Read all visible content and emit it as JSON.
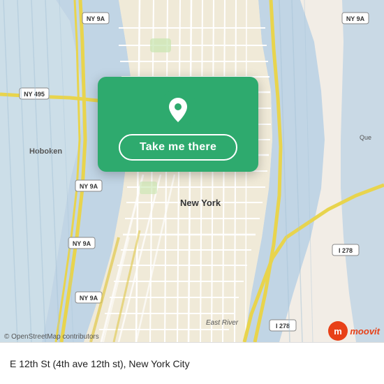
{
  "map": {
    "attribution": "© OpenStreetMap contributors",
    "background_color": "#e8ddd0"
  },
  "card": {
    "button_label": "Take me there"
  },
  "bottom_bar": {
    "location_text": "E 12th St (4th ave 12th st), New York City"
  },
  "moovit": {
    "text": "moovit"
  },
  "labels": {
    "hoboken": "Hoboken",
    "new_york": "New York",
    "ny_9a_1": "NY 9A",
    "ny_9a_2": "NY 9A",
    "ny_9a_3": "NY 9A",
    "ny_9a_4": "NY 9A",
    "ny_495": "NY 495",
    "i278": "I 278",
    "i278_2": "I 278"
  }
}
